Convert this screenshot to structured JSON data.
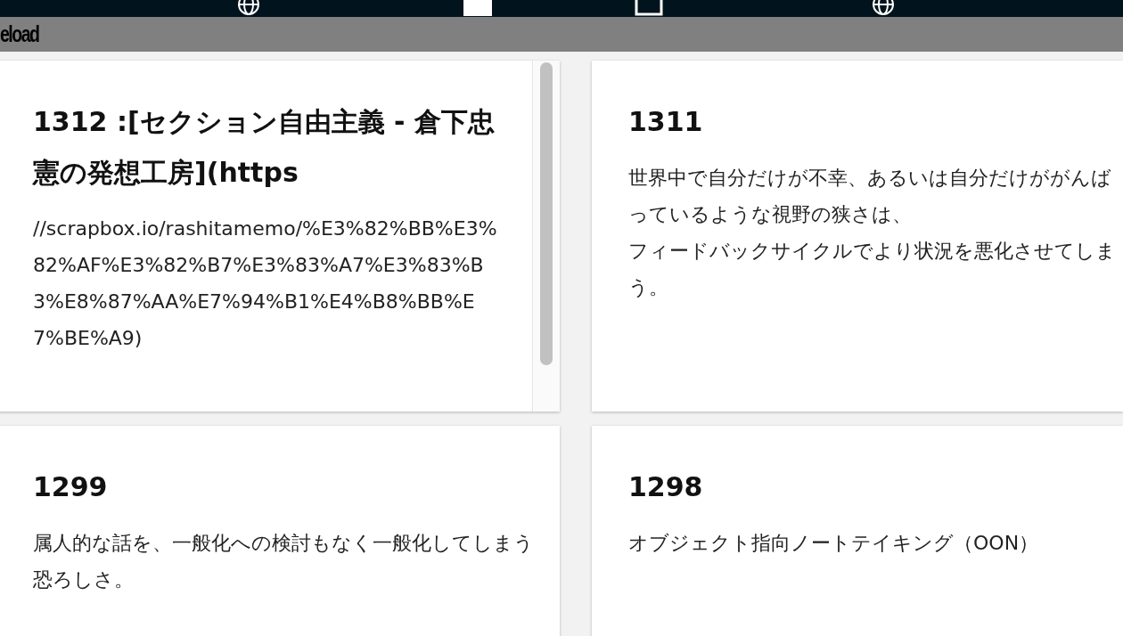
{
  "reload_bar": {
    "label": "eload"
  },
  "cards": [
    {
      "title": "1312 :[セクション自由主義 - 倉下忠憲の発想工房](https",
      "body": [
        "//scrapbox.io/rashitamemo/%E3%82%BB%E3%82%AF%E3%82%B7%E3%83%A7%E3%83%B3%E8%87%AA%E7%94%B1%E4%B8%BB%E7%BE%A9)"
      ],
      "scrollable": true
    },
    {
      "title": "1311",
      "body": [
        "世界中で自分だけが不幸、あるいは自分だけががんばっているような視野の狭さは、",
        "フィードバックサイクルでより状況を悪化させてしまう。"
      ],
      "scrollable": false
    },
    {
      "title": "1299",
      "body": [
        "属人的な話を、一般化への検討もなく一般化してしまう恐ろしさ。"
      ],
      "scrollable": false
    },
    {
      "title": "1298",
      "body": [
        "オブジェクト指向ノートテイキング（OON）"
      ],
      "scrollable": false
    }
  ]
}
